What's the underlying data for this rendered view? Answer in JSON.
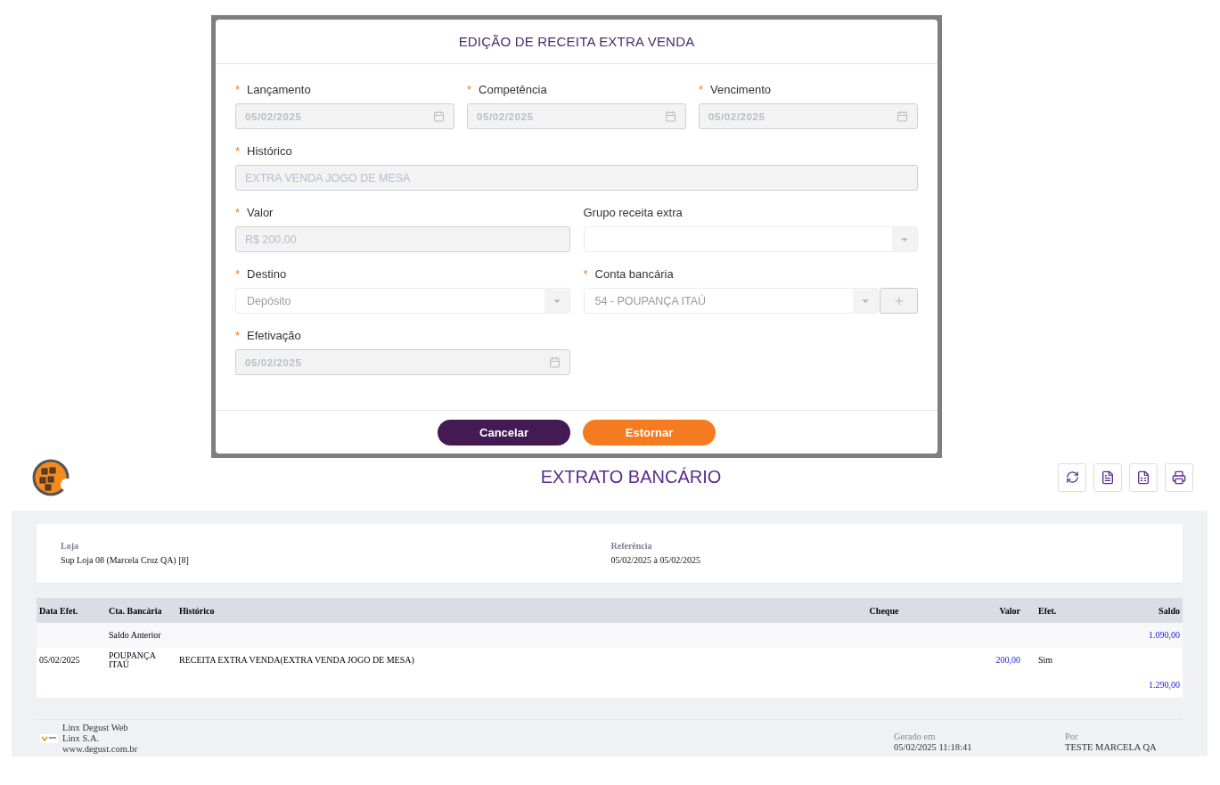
{
  "dialog": {
    "title": "EDIÇÃO DE RECEITA EXTRA VENDA",
    "rows": [
      [
        {
          "required_mark": "*",
          "label": "Lançamento",
          "kind": "date",
          "value": "05/02/2025",
          "disabled": true
        },
        {
          "required_mark": "*",
          "label": "Competência",
          "kind": "date",
          "value": "05/02/2025",
          "disabled": true
        },
        {
          "required_mark": "*",
          "label": "Vencimento",
          "kind": "date",
          "value": "05/02/2025",
          "disabled": true
        }
      ],
      [
        {
          "required_mark": "*",
          "label": "Histórico",
          "kind": "text",
          "value": "EXTRA VENDA JOGO DE MESA",
          "disabled": true,
          "full_width": true
        }
      ],
      [
        {
          "required_mark": "*",
          "label": "Valor",
          "kind": "text",
          "value": "R$ 200,00",
          "disabled": true
        },
        {
          "label": "Grupo receita extra",
          "kind": "select"
        }
      ],
      [
        {
          "required_mark": "*",
          "label": "Destino",
          "kind": "select",
          "value": "Depósito"
        },
        {
          "required_mark": "*",
          "label": "Conta bancária",
          "kind": "select_add",
          "value": "54 - POUPANÇA ITAÚ"
        }
      ],
      [
        {
          "required_mark": "*",
          "label": "Efetivação",
          "kind": "date",
          "value": "05/02/2025",
          "disabled": true
        }
      ]
    ],
    "buttons": [
      {
        "label": "Cancelar",
        "kind": "secondary"
      },
      {
        "label": "Estornar",
        "kind": "primary"
      }
    ]
  },
  "report": {
    "title": "EXTRATO BANCÁRIO",
    "toolbar": [
      {
        "kind": "refresh"
      },
      {
        "kind": "pdf"
      },
      {
        "kind": "xls"
      },
      {
        "kind": "print"
      }
    ],
    "info": [
      {
        "label": "Loja",
        "value": "Sup Loja 08 (Marcela Cruz QA) [8]"
      },
      {
        "label": "Referência",
        "value": "05/02/2025 à 05/02/2025"
      }
    ],
    "table": {
      "columns": [
        "Data Efet.",
        "Cta. Bancária",
        "Histórico",
        "Cheque",
        "Valor",
        "Efet.",
        "Saldo"
      ],
      "rows": [
        [
          null,
          "Saldo Anterior",
          null,
          null,
          null,
          null,
          "1.090,00"
        ],
        [
          "05/02/2025",
          "POUPANÇA ITAÚ",
          "RECEITA EXTRA VENDA(EXTRA VENDA JOGO DE MESA)",
          null,
          "200,00",
          "Sim",
          null
        ],
        [
          null,
          null,
          null,
          null,
          null,
          null,
          "1.290,00"
        ]
      ]
    },
    "footer": {
      "company_lines": [
        "Linx Degust Web",
        "Linx S.A.",
        "www.degust.com.br"
      ],
      "generated_label": "Gerado em",
      "generated_value": "05/02/2025 11:18:41",
      "by_label": "Por",
      "by_value": "TESTE MARCELA QA"
    }
  }
}
